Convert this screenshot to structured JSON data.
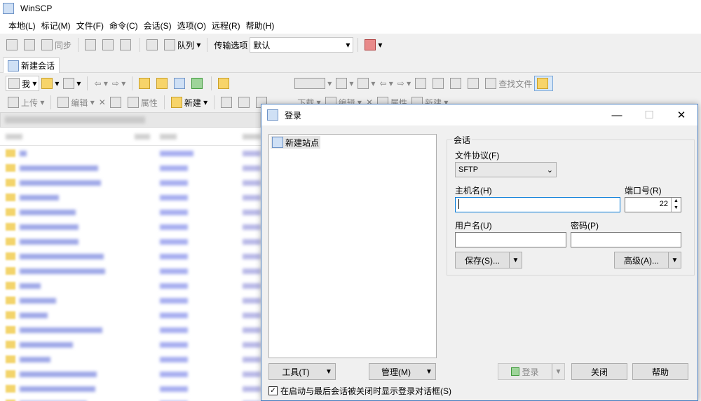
{
  "app": {
    "title": "WinSCP"
  },
  "menu": [
    "本地(L)",
    "标记(M)",
    "文件(F)",
    "命令(C)",
    "会话(S)",
    "选项(O)",
    "远程(R)",
    "帮助(H)"
  ],
  "toolbar1": {
    "sync_label": "同步",
    "queue_label": "队列",
    "transfer_options_label": "传输选项",
    "transfer_options_value": "默认"
  },
  "tab": {
    "new_session_label": "新建会话"
  },
  "toolbar2": {
    "drive_label": "我",
    "find_files_label": "查找文件"
  },
  "toolbar3": {
    "upload_label": "上传",
    "edit_label": "编辑",
    "properties_label": "属性",
    "new_label": "新建",
    "download_label": "下载",
    "edit_label_r": "编辑",
    "properties_label_r": "属性",
    "new_label_r": "新建"
  },
  "dialog": {
    "title": "登录",
    "site_tree": {
      "items": [
        "新建站点"
      ]
    },
    "session_group_label": "会话",
    "protocol_label": "文件协议(F)",
    "protocol_value": "SFTP",
    "hostname_label": "主机名(H)",
    "hostname_value": "",
    "port_label": "端口号(R)",
    "port_value": "22",
    "username_label": "用户名(U)",
    "username_value": "",
    "password_label": "密码(P)",
    "password_value": "",
    "save_button": "保存(S)...",
    "advanced_button": "高级(A)...",
    "tools_button": "工具(T)",
    "manage_button": "管理(M)",
    "login_button": "登录",
    "close_button": "关闭",
    "help_button": "帮助",
    "checkbox_label": "在启动与最后会话被关闭时显示登录对话框(S)",
    "checkbox_checked": true
  }
}
